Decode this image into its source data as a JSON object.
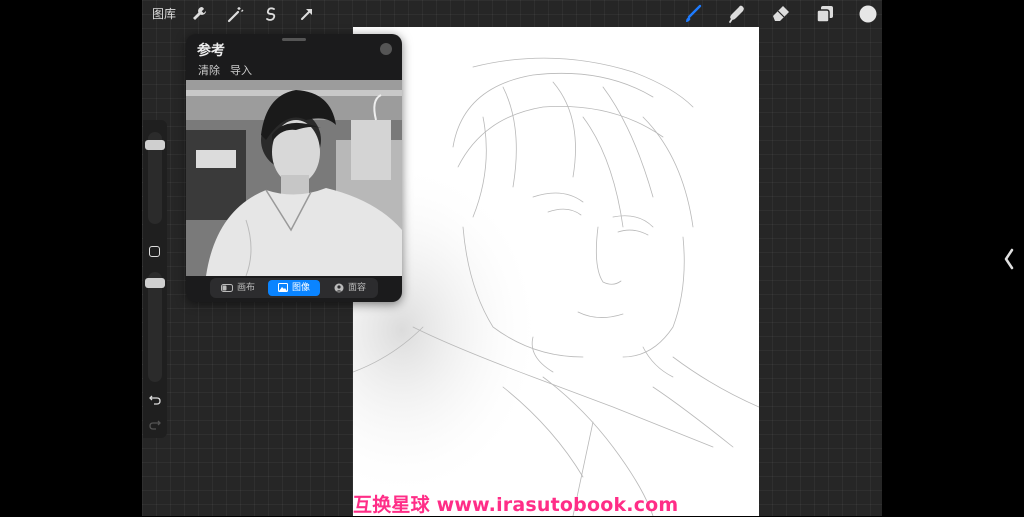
{
  "toolbar": {
    "gallery_label": "图库",
    "left_icons": [
      "wrench-icon",
      "magic-wand-icon",
      "selection-icon",
      "transform-arrow-icon"
    ],
    "right_icons": [
      "brush-icon",
      "smudge-icon",
      "eraser-icon",
      "layers-icon",
      "color-icon"
    ],
    "brush_color": "#1e7bff"
  },
  "reference_panel": {
    "title": "参考",
    "actions": [
      "清除",
      "导入"
    ],
    "tabs": [
      {
        "label": "画布",
        "icon": "canvas-toggle-icon",
        "active": false
      },
      {
        "label": "图像",
        "icon": "image-icon",
        "active": true
      },
      {
        "label": "面容",
        "icon": "face-icon",
        "active": false
      }
    ]
  },
  "watermark": "互换星球 www.irasutobook.com",
  "colors": {
    "accent": "#0a84ff",
    "watermark": "#ff2d87",
    "workspace": "#262626"
  }
}
